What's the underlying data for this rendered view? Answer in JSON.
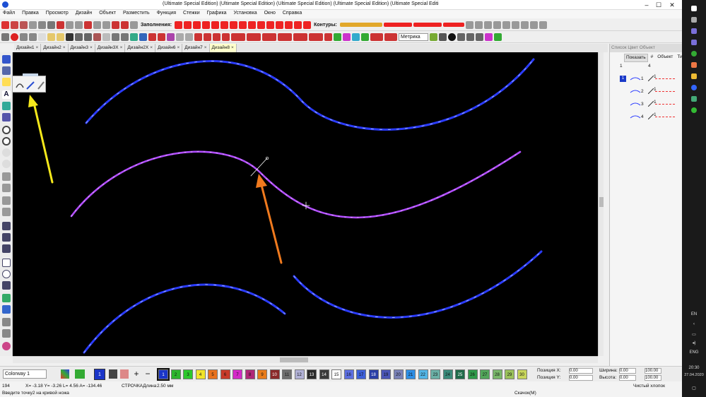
{
  "window": {
    "title": "(Ultimate Special Edition) (Ultimate Special Edition) (Ultimate Special Edition) (Ultimate Special Edition) (Ultimate Special Editi",
    "min": "–",
    "max": "☐",
    "close": "✕"
  },
  "menu": [
    "Файл",
    "Правка",
    "Просмотр",
    "Дизайн",
    "Объект",
    "Разместить",
    "Функция",
    "Стежки",
    "Графика",
    "Установка",
    "Окно",
    "Справка"
  ],
  "toolbar1": {
    "fills_label": "Заполнения:",
    "contours_label": "Контуры:"
  },
  "toolbar2": {
    "units": "Метрика"
  },
  "tabs": [
    "Дизайн1",
    "Дизайн2",
    "Дизайн3",
    "Дизайн3X",
    "Дизайн2X",
    "Дизайн6",
    "Дизайн7",
    "Дизайн8"
  ],
  "panel": {
    "header": "Список Цвет Объект",
    "tab_show": "Показать",
    "col_hash": "#",
    "col_object": "Объект",
    "col_type": "Тип",
    "header_num1": "1",
    "header_num2": "4",
    "rows": [
      {
        "num": "1",
        "needle": "1"
      },
      {
        "num": "2",
        "needle": "1"
      },
      {
        "num": "3",
        "needle": "1"
      },
      {
        "num": "4",
        "needle": "1"
      }
    ],
    "group_num": "1"
  },
  "bottom": {
    "colorway": "Colorway 1",
    "current_color": "1",
    "swatches": [
      {
        "n": "1",
        "c": "#1a35c8"
      },
      {
        "n": "2",
        "c": "#2db52d"
      },
      {
        "n": "3",
        "c": "#2bc82b"
      },
      {
        "n": "4",
        "c": "#f2e42a"
      },
      {
        "n": "5",
        "c": "#e9721e"
      },
      {
        "n": "6",
        "c": "#c83a2a"
      },
      {
        "n": "7",
        "c": "#d42ac8"
      },
      {
        "n": "8",
        "c": "#b02878"
      },
      {
        "n": "9",
        "c": "#e87c1a"
      },
      {
        "n": "10",
        "c": "#8a2a2a"
      },
      {
        "n": "11",
        "c": "#6e6e6e"
      },
      {
        "n": "12",
        "c": "#b1b1d6"
      },
      {
        "n": "13",
        "c": "#2a2a2a"
      },
      {
        "n": "14",
        "c": "#3a3a3a"
      },
      {
        "n": "15",
        "c": "#ffffff"
      },
      {
        "n": "16",
        "c": "#5c6ee0"
      },
      {
        "n": "17",
        "c": "#3c5fd9"
      },
      {
        "n": "18",
        "c": "#2a3fa6"
      },
      {
        "n": "19",
        "c": "#4a56b6"
      },
      {
        "n": "20",
        "c": "#7a82b8"
      },
      {
        "n": "21",
        "c": "#2d8fe6"
      },
      {
        "n": "22",
        "c": "#52b5e6"
      },
      {
        "n": "23",
        "c": "#6ab0a6"
      },
      {
        "n": "24",
        "c": "#3a8a7a"
      },
      {
        "n": "25",
        "c": "#1f6a4a"
      },
      {
        "n": "26",
        "c": "#2e9a4a"
      },
      {
        "n": "27",
        "c": "#52a65a"
      },
      {
        "n": "28",
        "c": "#7ab86a"
      },
      {
        "n": "29",
        "c": "#9ac25a"
      },
      {
        "n": "30",
        "c": "#c8d65a"
      }
    ],
    "pos_x_label": "Позиция X:",
    "pos_x": "0.00",
    "pos_y_label": "Позиция Y:",
    "pos_y": "0.00",
    "width_label": "Ширина:",
    "width": "0.00",
    "height_label": "Высота:",
    "height": "0.00",
    "pct_w": "100.00",
    "pct_h": "100.00"
  },
  "status": {
    "stitch_count": "194",
    "coords": "X= -3.18 Y= -3.26 L= 4.56 A= -134.46",
    "mode": "СТРОЧКАДлина",
    "length": "2.50 мм",
    "hint": "Введите точку2 на кривой ножа",
    "download": "Скачок(М)",
    "stitch_type": "Чистый хлопок"
  },
  "taskbar": {
    "lang": "EN",
    "lang2": "ENG",
    "time": "20:30",
    "date": "27.04.2020"
  },
  "colors": {
    "blue_curve": "#2a3bff",
    "purple_curve": "#b14cff",
    "yellow_arrow": "#f5e81b",
    "orange_arrow": "#f07a1e"
  },
  "icons": [
    "pointer-icon",
    "node-edit-icon",
    "knife-icon",
    "text-icon",
    "fill-icon",
    "circle-icon"
  ]
}
